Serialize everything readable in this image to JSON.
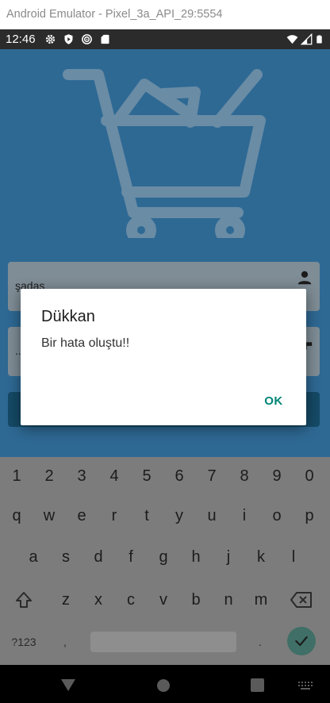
{
  "emulator": {
    "title": "Android Emulator - Pixel_3a_API_29:5554"
  },
  "status_bar": {
    "time": "12:46",
    "left_icons": [
      "gear-icon",
      "play-protect-icon",
      "radar-icon",
      "sd-card-icon"
    ],
    "right_icons": [
      "wifi-icon",
      "cell-signal-icon",
      "battery-icon"
    ]
  },
  "app": {
    "background_color": "#2e6994",
    "logo_icon": "shopping-cart-icon",
    "username_field": {
      "value": "şadas",
      "icon": "person-icon"
    },
    "password_field": {
      "value": "..",
      "icon": "key-icon"
    },
    "login_button": {
      "label": ""
    }
  },
  "dialog": {
    "title": "Dükkan",
    "message": "Bir hata oluştu!!",
    "ok_label": "OK"
  },
  "keyboard": {
    "number_row": [
      "1",
      "2",
      "3",
      "4",
      "5",
      "6",
      "7",
      "8",
      "9",
      "0"
    ],
    "row1": [
      "q",
      "w",
      "e",
      "r",
      "t",
      "y",
      "u",
      "i",
      "o",
      "p"
    ],
    "row2": [
      "a",
      "s",
      "d",
      "f",
      "g",
      "h",
      "j",
      "k",
      "l"
    ],
    "row3": [
      "z",
      "x",
      "c",
      "v",
      "b",
      "n",
      "m"
    ],
    "symbols_label": "?123",
    "comma": ",",
    "period": "."
  },
  "nav_bar": {
    "buttons": [
      "back-icon",
      "home-icon",
      "recents-icon",
      "keyboard-switch-icon"
    ]
  }
}
